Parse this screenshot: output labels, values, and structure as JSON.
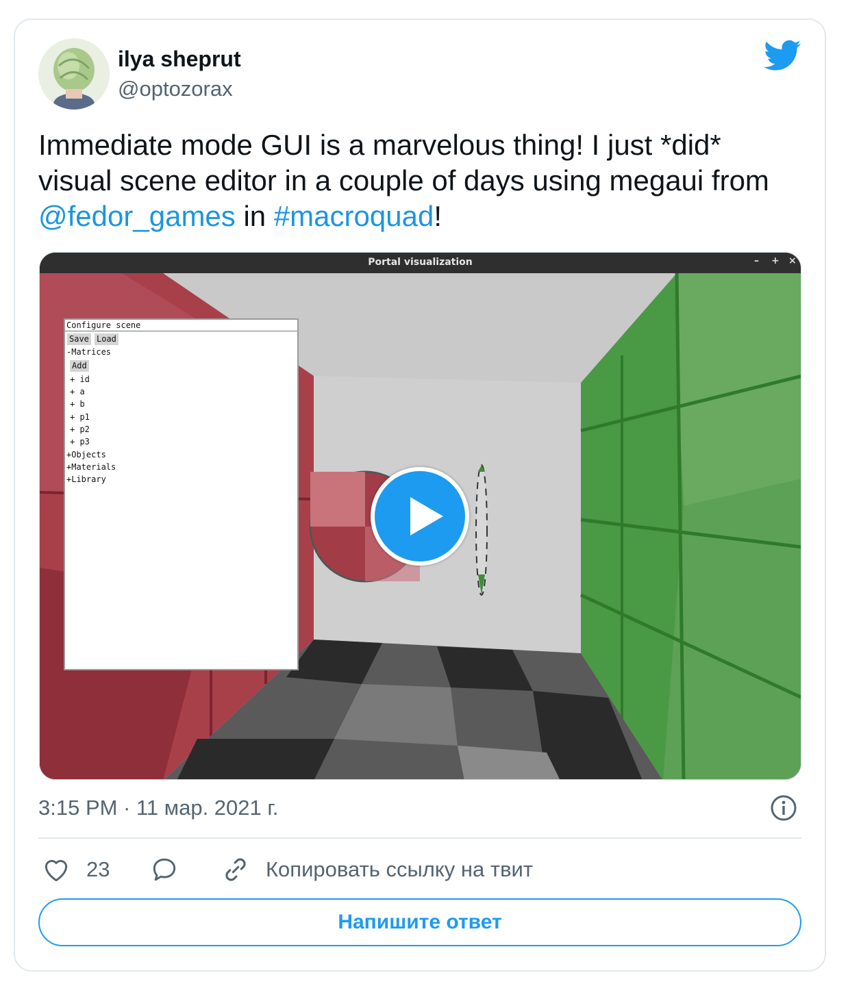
{
  "author": {
    "name": "ilya sheprut",
    "handle": "@optozorax",
    "avatar_icon": "cabbage-avatar-icon"
  },
  "brand": {
    "icon": "twitter-bird-icon",
    "color": "#1d9bf0"
  },
  "tweet": {
    "text_line1": "Immediate mode GUI is a marvelous thing! I just *did*",
    "text_line2": "visual scene editor in a couple of days using megaui from",
    "mention": "@fedor_games",
    "text_middle": " in ",
    "hashtag": "#macroquad",
    "text_end": "!"
  },
  "media": {
    "window_title": "Portal visualization",
    "window_buttons": [
      "–",
      "+",
      "×"
    ],
    "panel": {
      "title": "Configure scene",
      "save_label": "Save",
      "load_label": "Load",
      "matrices_label": "-Matrices",
      "add_label": "Add",
      "matrix_items": [
        "+ id",
        "+ a",
        "+ b",
        "+ p1",
        "+ p2",
        "+ p3"
      ],
      "sections": [
        "+Objects",
        "+Materials",
        "+Library"
      ]
    },
    "play_icon": "play-icon"
  },
  "meta": {
    "timestamp": "3:15 PM · 11 мар. 2021 г.",
    "info_icon": "info-icon"
  },
  "actions": {
    "like_icon": "heart-icon",
    "like_count": "23",
    "reply_icon": "comment-icon",
    "link_icon": "link-icon",
    "copy_link_label": "Копировать ссылку на твит"
  },
  "reply_button_label": "Напишите ответ"
}
